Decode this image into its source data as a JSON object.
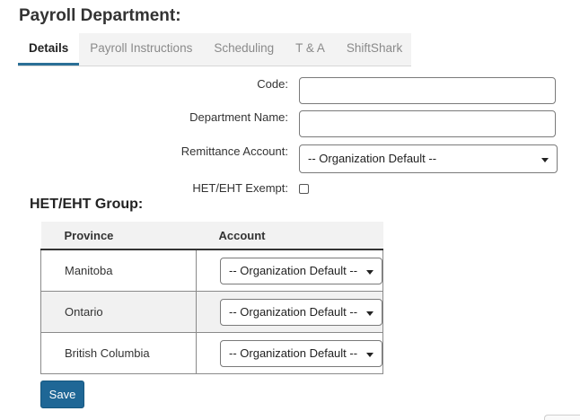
{
  "page": {
    "title": "Payroll Department:"
  },
  "tabs": [
    {
      "label": "Details",
      "active": true
    },
    {
      "label": "Payroll Instructions",
      "active": false
    },
    {
      "label": "Scheduling",
      "active": false
    },
    {
      "label": "T & A",
      "active": false
    },
    {
      "label": "ShiftShark",
      "active": false
    }
  ],
  "form": {
    "code_label": "Code:",
    "code_value": "",
    "department_name_label": "Department Name:",
    "department_name_value": "",
    "remittance_label": "Remittance Account:",
    "remittance_value": "-- Organization Default --",
    "exempt_label": "HET/EHT Exempt:",
    "exempt_checked": false
  },
  "het_group": {
    "title": "HET/EHT Group:",
    "columns": [
      "Province",
      "Account"
    ],
    "rows": [
      {
        "province": "Manitoba",
        "account": "-- Organization Default --"
      },
      {
        "province": "Ontario",
        "account": "-- Organization Default --"
      },
      {
        "province": "British Columbia",
        "account": "-- Organization Default --"
      }
    ]
  },
  "actions": {
    "save_label": "Save"
  },
  "colors": {
    "accent": "#1f6796",
    "tab_underline": "#2a6f97",
    "tab_bar_bg": "#f3f3f3",
    "row_alt_bg": "#f1f1f1"
  },
  "icons": {
    "dropdown": "caret-down-icon"
  }
}
